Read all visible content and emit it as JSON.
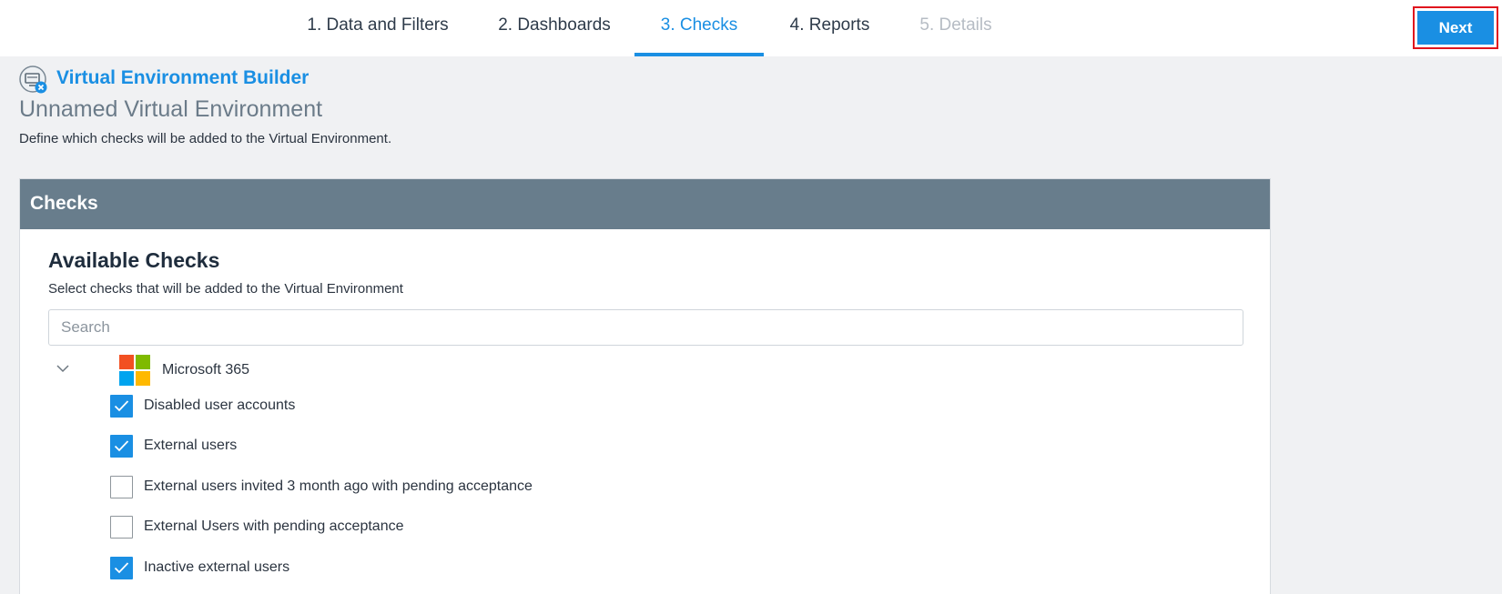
{
  "wizard": {
    "tabs": [
      {
        "label": "1. Data and Filters",
        "state": "normal"
      },
      {
        "label": "2. Dashboards",
        "state": "normal"
      },
      {
        "label": "3. Checks",
        "state": "active"
      },
      {
        "label": "4. Reports",
        "state": "normal"
      },
      {
        "label": "5. Details",
        "state": "disabled"
      }
    ],
    "next_label": "Next"
  },
  "header": {
    "builder_title": "Virtual Environment Builder",
    "env_name": "Unnamed Virtual Environment",
    "description": "Define which checks will be added to the Virtual Environment."
  },
  "panel": {
    "title": "Checks",
    "available_title": "Available Checks",
    "available_subtitle": "Select checks that will be added to the Virtual Environment",
    "search_placeholder": "Search",
    "search_value": ""
  },
  "group": {
    "label": "Microsoft 365",
    "expanded": true,
    "logo_colors": [
      "#f25022",
      "#7fba00",
      "#00a4ef",
      "#ffb900"
    ]
  },
  "checks": [
    {
      "label": "Disabled user accounts",
      "checked": true
    },
    {
      "label": "External users",
      "checked": true
    },
    {
      "label": "External users invited 3 month ago with pending acceptance",
      "checked": false
    },
    {
      "label": "External Users with pending acceptance",
      "checked": false
    },
    {
      "label": "Inactive external users",
      "checked": true
    }
  ],
  "colors": {
    "accent": "#1a8fe3",
    "panel_header": "#687d8c",
    "highlight_outline": "#e0141e"
  }
}
